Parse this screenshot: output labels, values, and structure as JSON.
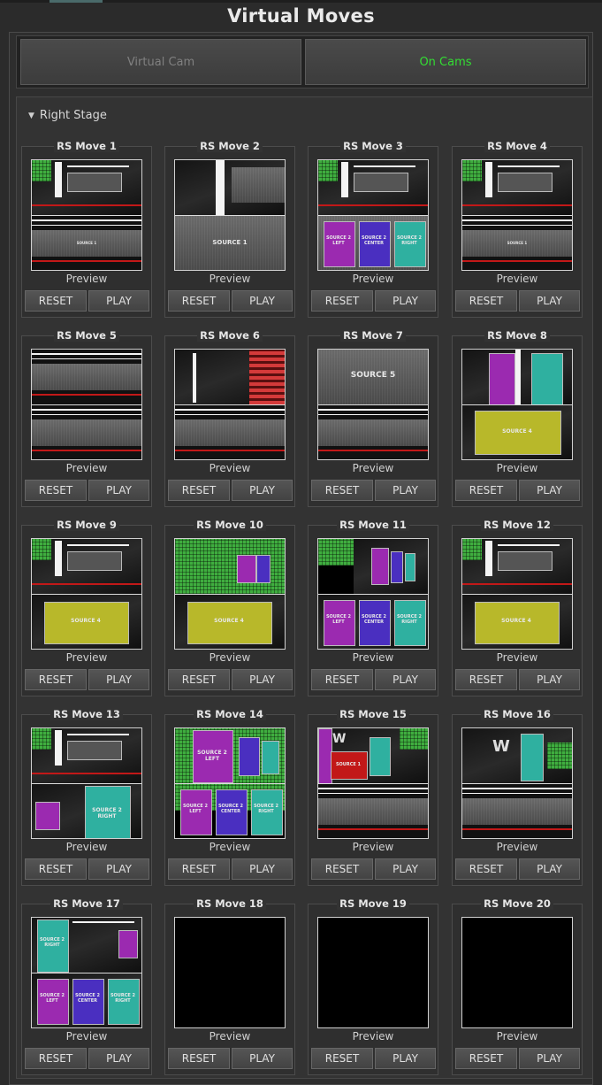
{
  "header": {
    "title": "Virtual Moves"
  },
  "camera_modes": [
    {
      "label": "Virtual Cam",
      "color": "#808080"
    },
    {
      "label": "On Cams",
      "color": "#33dd33"
    }
  ],
  "stage": {
    "label": "Right Stage",
    "collapse_icon": "triangle-down-icon"
  },
  "buttons": {
    "reset": "RESET",
    "play": "PLAY",
    "preview": "Preview"
  },
  "moves": [
    {
      "name": "RS Move 1",
      "scene": "source1"
    },
    {
      "name": "RS Move 2",
      "scene": "source1b",
      "screen_text": "SOURCE 1"
    },
    {
      "name": "RS Move 3",
      "scene": "lcr"
    },
    {
      "name": "RS Move 4",
      "scene": "wide"
    },
    {
      "name": "RS Move 5",
      "scene": "double"
    },
    {
      "name": "RS Move 6",
      "scene": "redlights"
    },
    {
      "name": "RS Move 7",
      "scene": "source5",
      "screen_text": "SOURCE 5"
    },
    {
      "name": "RS Move 8",
      "scene": "source4a",
      "screen_text": "SOURCE 4"
    },
    {
      "name": "RS Move 9",
      "scene": "source4b",
      "screen_text": "SOURCE 4"
    },
    {
      "name": "RS Move 10",
      "scene": "source4c",
      "screen_text": "SOURCE 4"
    },
    {
      "name": "RS Move 11",
      "scene": "lcr2",
      "lcr_texts": [
        "SOURCE 2 LEFT",
        "SOURCE 2 CENTER",
        "SOURCE 2 RIGHT"
      ]
    },
    {
      "name": "RS Move 12",
      "scene": "source4d",
      "screen_text": "SOURCE 4"
    },
    {
      "name": "RS Move 13",
      "scene": "right2",
      "screen_text": "SOURCE 2 RIGHT"
    },
    {
      "name": "RS Move 14",
      "scene": "lcr3",
      "top_text": "SOURCE 2 LEFT",
      "lcr_texts": [
        "SOURCE 2 LEFT",
        "SOURCE 2 CENTER",
        "SOURCE 2 RIGHT"
      ]
    },
    {
      "name": "RS Move 15",
      "scene": "ww1",
      "screen_text": "SOURCE 1"
    },
    {
      "name": "RS Move 16",
      "scene": "ww2"
    },
    {
      "name": "RS Move 17",
      "scene": "lcr4",
      "top_text": "SOURCE 2 RIGHT",
      "lcr_texts": [
        "SOURCE 2 LEFT",
        "SOURCE 2 CENTER",
        "SOURCE 2 RIGHT"
      ]
    },
    {
      "name": "RS Move 18",
      "scene": "empty"
    },
    {
      "name": "RS Move 19",
      "scene": "empty"
    },
    {
      "name": "RS Move 20",
      "scene": "empty"
    }
  ],
  "colors": {
    "accent_green": "#33dd33",
    "panel_purple": "#9b2ab0",
    "panel_blue": "#4a2fc0",
    "panel_teal": "#2fb0a0",
    "screen_yellow": "#b8b82a",
    "set_red": "#c21818"
  }
}
